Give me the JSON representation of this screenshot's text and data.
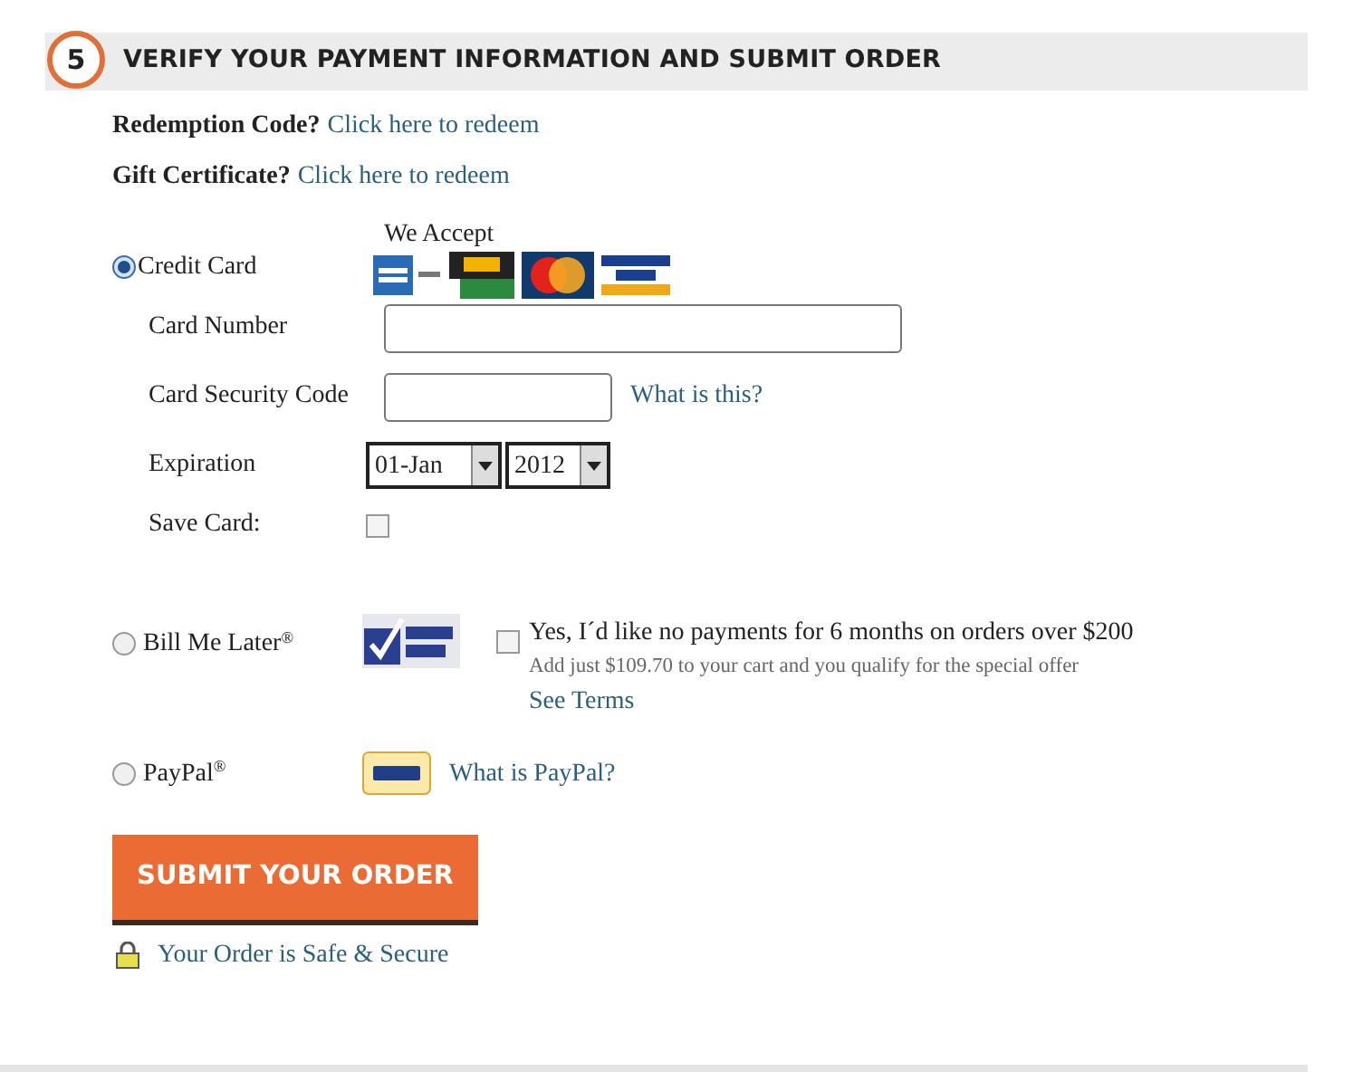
{
  "step": {
    "number": "5",
    "title": "VERIFY YOUR PAYMENT INFORMATION AND SUBMIT ORDER"
  },
  "prompts": [
    {
      "label": "Redemption Code?",
      "link": "Click here to redeem"
    },
    {
      "label": "Gift Certificate?",
      "link": "Click here to redeem"
    }
  ],
  "credit_card": {
    "label": "Credit Card",
    "selected": true,
    "accept_label": "We Accept",
    "card_number": {
      "label": "Card Number"
    },
    "security_code": {
      "label": "Card Security Code",
      "help_link": "What is this?"
    },
    "expiration": {
      "label": "Expiration",
      "month": "01-Jan",
      "year": "2012"
    },
    "save_card": {
      "label": "Save Card:",
      "checked": false
    }
  },
  "bill_me_later": {
    "label": "Bill Me Later$^{®}$",
    "selected": false,
    "offer": {
      "text": "Yes, I´d like no payments for 6 months on orders over $200",
      "checked": false,
      "note": "Add just $109.70 to your cart and you qualify for the special offer",
      "link": "See Terms"
    }
  },
  "paypal": {
    "label": "PayPal$^{®}$",
    "selected": false,
    "link": "What is PayPal?"
  },
  "submit_button": "SUBMIT YOUR ORDER",
  "secure_note": "Your Order is Safe & Secure"
}
